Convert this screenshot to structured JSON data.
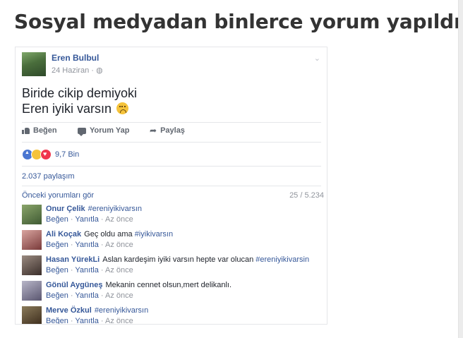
{
  "headline": "Sosyal medyadan binlerce yorum yapıldı",
  "post": {
    "author": "Eren Bulbul",
    "date": "24 Haziran",
    "meta_sep": " · ",
    "audience_icon": "globe-icon",
    "chevron": "⌄",
    "text_line1": "Biride cikip demiyoki",
    "text_line2": "Eren iyiki varsın",
    "actions": {
      "like": "Beğen",
      "comment": "Yorum Yap",
      "share": "Paylaş"
    },
    "reactions": {
      "icons": [
        "like-reaction-icon",
        "sad-reaction-icon",
        "love-reaction-icon"
      ],
      "count": "9,7 Bin"
    },
    "shares": "2.037 paylaşım",
    "previous_comments": "Önceki yorumları gör",
    "comment_counter": "25 / 5.234"
  },
  "comments": [
    {
      "name": "Onur Çelik",
      "text": "",
      "tag": "#ereniyikivarsın",
      "like": "Beğen",
      "reply": "Yanıtla",
      "time": "Az önce"
    },
    {
      "name": "Ali Koçak",
      "text": "Geç oldu ama ",
      "tag": "#iyikivarsın",
      "like": "Beğen",
      "reply": "Yanıtla",
      "time": "Az önce"
    },
    {
      "name": "Hasan YürekLi",
      "text": "Aslan kardeşim iyiki varsın hepte var olucan ",
      "tag": "#ereniyikivarsin",
      "like": "Beğen",
      "reply": "Yanıtla",
      "time": "Az önce"
    },
    {
      "name": "Gönül Aygüneş",
      "text": "Mekanin cennet olsun,mert delikanlı.",
      "tag": "",
      "like": "Beğen",
      "reply": "Yanıtla",
      "time": "Az önce"
    },
    {
      "name": "Merve Özkul",
      "text": "",
      "tag": "#ereniyikivarsın",
      "like": "Beğen",
      "reply": "Yanıtla",
      "time": "Az önce"
    }
  ],
  "sep": " · ",
  "colors": {
    "link": "#365899",
    "muted": "#90949c",
    "headline": "#333333"
  }
}
